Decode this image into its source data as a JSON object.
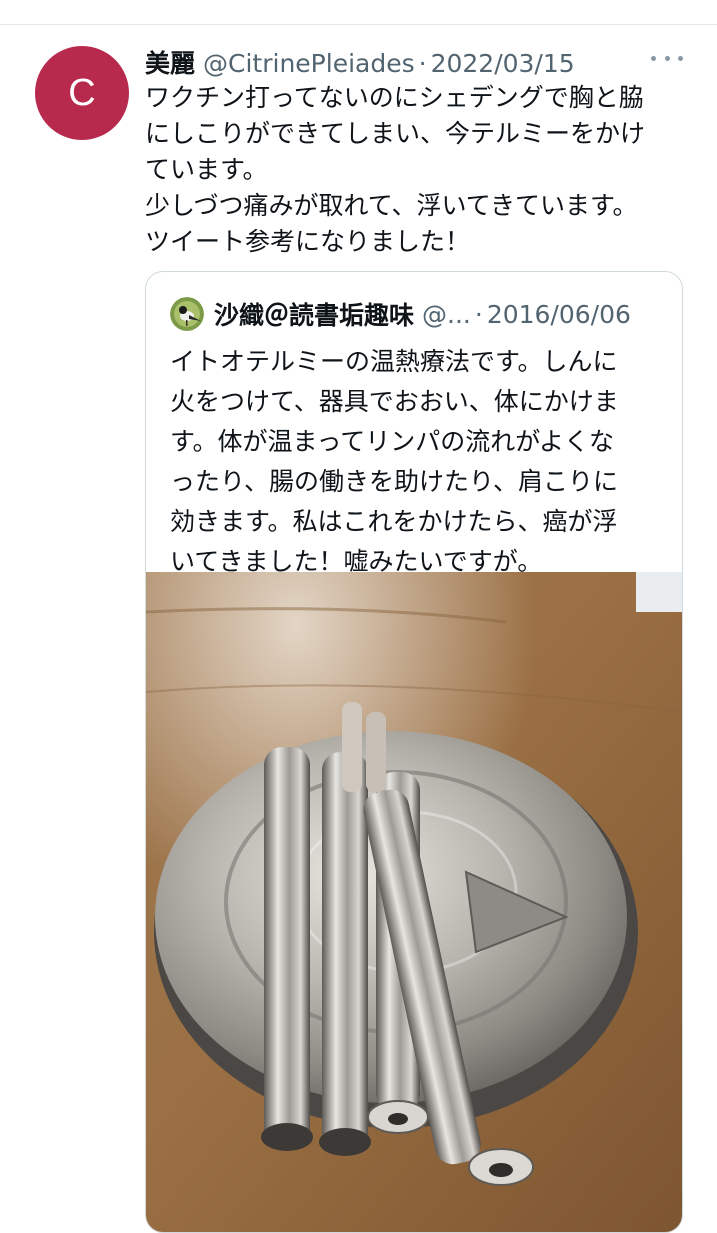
{
  "tweet": {
    "avatar_letter": "C",
    "display_name": "美麗",
    "handle": "@CitrinePleiades",
    "separator": "·",
    "date": "2022/03/15",
    "text": "ワクチン打ってないのにシェデングで胸と脇\nにしこりができてしまい、今テルミーをかけ\nています。\n少しづつ痛みが取れて、浮いてきています。\nツイート参考になりました！"
  },
  "quoted_tweet": {
    "display_name": "沙織＠読書垢趣味",
    "handle": "@...",
    "separator": "·",
    "date": "2016/06/06",
    "text": "イトオテルミーの温熱療法です。しんに\n火をつけて、器具でおおい、体にかけま\nす。体が温まってリンパの流れがよくな\nったり、腸の働きを助けたり、肩こりに\n効きます。私はこれをかけたら、癌が浮\nいてきました！嘘みたいですが。"
  },
  "icons": {
    "more": "more-horizontal-icon",
    "quoted_avatar": "bird-avatar-icon"
  },
  "colors": {
    "avatar_bg": "#b8294e",
    "secondary_text": "#536471",
    "border": "#cfd9de"
  }
}
